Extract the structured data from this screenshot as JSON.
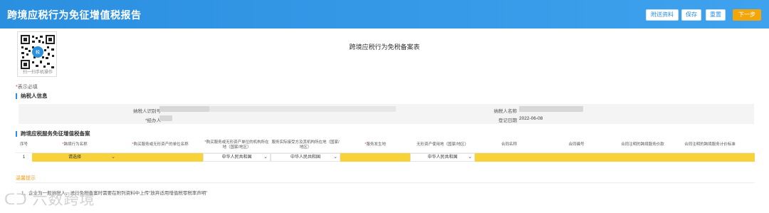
{
  "header": {
    "title": "跨境应税行为免征增值税报告",
    "buttons": [
      "附送资料",
      "保存",
      "重置",
      "下一步"
    ]
  },
  "qr": {
    "caption": "扫一扫手机操作"
  },
  "form_title": "跨境应税行为免税备案表",
  "required_note": {
    "star": "*",
    "text": "表示必填"
  },
  "taxpayer_section": {
    "title": "纳税人信息",
    "fields": {
      "tax_id_label": "纳税人识别号",
      "name_label": "纳税人名称",
      "agent_label": "*经办人",
      "date_label": "登记日期",
      "date_value": "2022-06-08"
    }
  },
  "service_section": {
    "title": "跨境应税服务免征增值税备案",
    "columns": [
      {
        "star": "",
        "text": "序号"
      },
      {
        "star": "*",
        "text": "跨境行为名称"
      },
      {
        "star": "*",
        "text": "购买服务或无形资产的单位名称"
      },
      {
        "star": "*",
        "text": "购买服务或无形资产单位的机构所在地（国家/地区）"
      },
      {
        "star": "",
        "text": "服务实际接受方及其机构所在地（国家/地区）"
      },
      {
        "star": "*",
        "text": "服务发生地"
      },
      {
        "star": "",
        "text": "无形资产使用地（国家/地区）"
      },
      {
        "star": "",
        "text": "合同名称"
      },
      {
        "star": "",
        "text": "合同编号"
      },
      {
        "star": "",
        "text": "合同注明的跨境服务价款"
      },
      {
        "star": "",
        "text": "合同注明的跨境服务计价标准"
      }
    ],
    "row": {
      "index": "1",
      "behavior_select": "请选择",
      "location1": "中华人民共和国",
      "location2": "中华人民共和国",
      "location3": "中华人民共和国"
    }
  },
  "tips": {
    "title": "温馨提示",
    "text": "1、企业为一般纳税人，进行免税备案时需要在附列资料中上传“放弃适用增值税零税率声明”"
  },
  "watermark": "六数跨境"
}
